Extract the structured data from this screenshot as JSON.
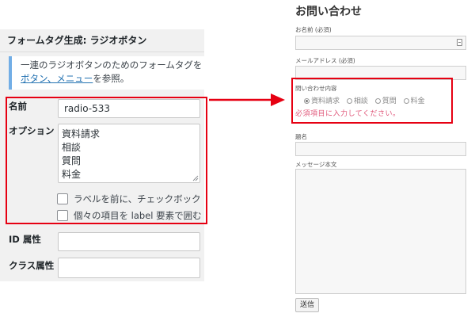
{
  "generator": {
    "title": "フォームタグ生成: ラジオボタン",
    "description_line1": "一連のラジオボタンのためのフォームタグを",
    "description_link": "ボタン、メニュー",
    "description_suffix": "を参照。",
    "name_label": "名前",
    "name_value": "radio-533",
    "options_label": "オプション",
    "options": [
      "資料請求",
      "相談",
      "質問",
      "料金"
    ],
    "checkbox1_label": "ラベルを前に、チェックボック",
    "checkbox2_label": "個々の項目を label 要素で囲む",
    "id_label": "ID 属性",
    "id_value": "",
    "class_label": "クラス属性",
    "class_value": ""
  },
  "contact_form": {
    "title": "お問い合わせ",
    "name_label": "お名前 (必須)",
    "email_label": "メールアドレス (必須)",
    "inquiry_label": "問い合わせ内容",
    "inquiry_options": [
      "資料請求",
      "相談",
      "質問",
      "料金"
    ],
    "selected_option": "資料請求",
    "error_message": "必須項目に入力してください。",
    "subject_label": "題名",
    "message_label": "メッセージ本文",
    "submit_label": "送信"
  },
  "colors": {
    "highlight_border": "#e60012",
    "arrow": "#e60012",
    "error_text": "#e0577a",
    "link": "#2271b1",
    "notice_border": "#72aee6"
  }
}
